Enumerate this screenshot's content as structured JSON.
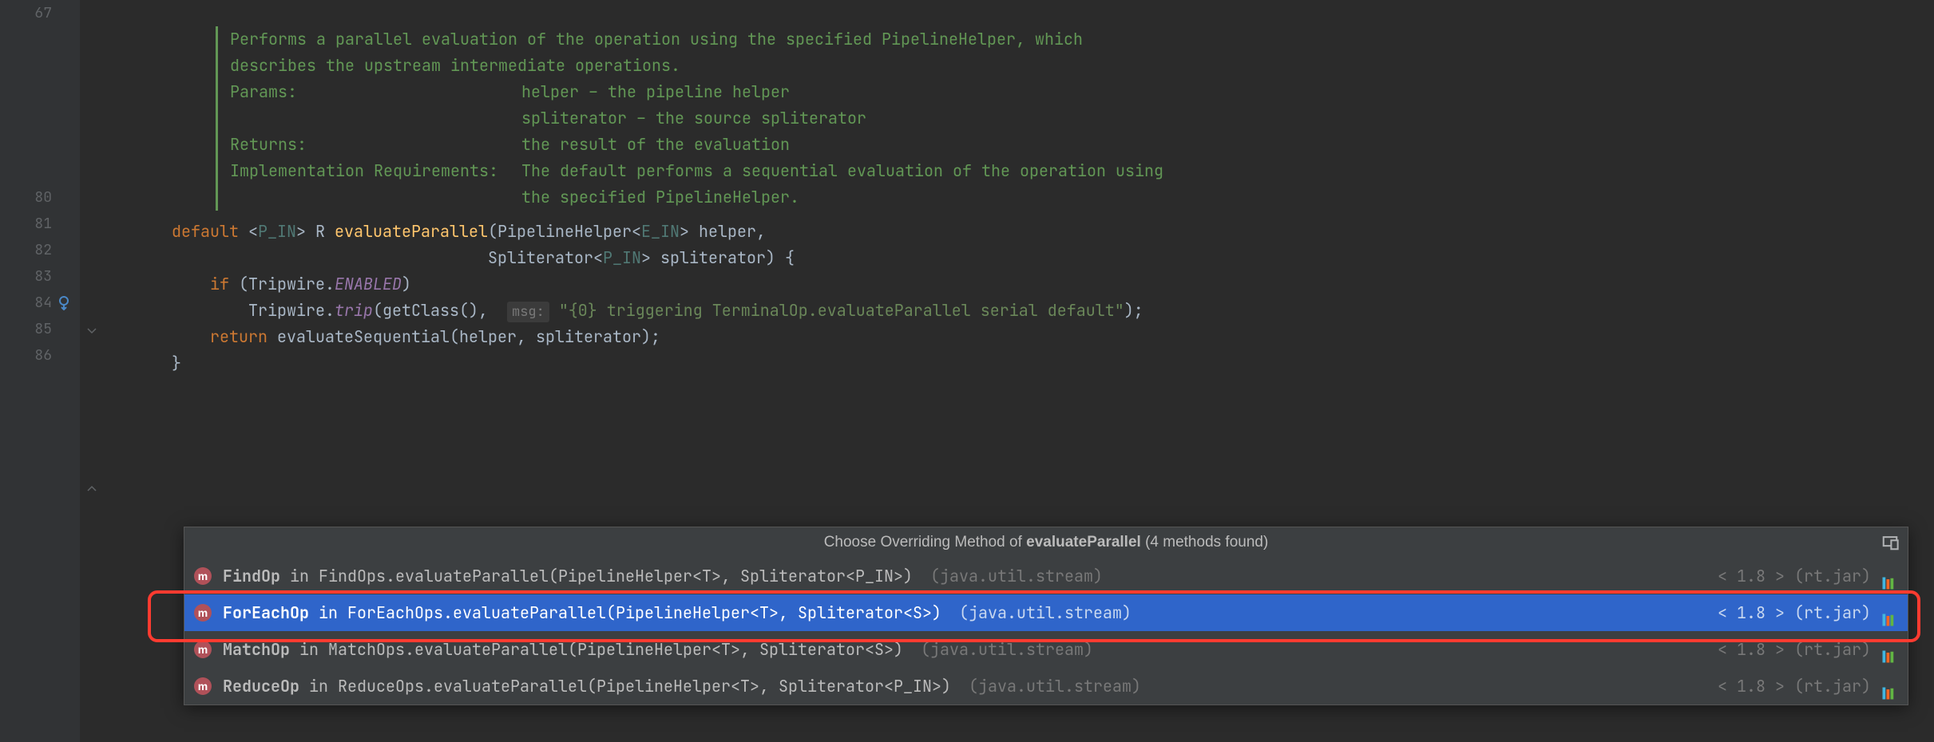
{
  "gutter": {
    "lines": [
      "67",
      "",
      "",
      "",
      "",
      "",
      "",
      "80",
      "81",
      "82",
      "83",
      "84",
      "85",
      "86"
    ]
  },
  "javadoc": {
    "desc1": "Performs a parallel evaluation of the operation using the specified PipelineHelper, which",
    "desc2": "describes the upstream intermediate operations.",
    "params_label": "Params:",
    "param1": "helper – the pipeline helper",
    "param2": "spliterator – the source spliterator",
    "returns_label": "Returns:",
    "returns_value": "the result of the evaluation",
    "impl_label": "Implementation Requirements:",
    "impl_value1": "The default performs a sequential evaluation of the operation using",
    "impl_value2": "the specified PipelineHelper."
  },
  "code": {
    "l80": {
      "default": "default ",
      "lt": "<",
      "p_in": "P_IN",
      "gt_r": "> R ",
      "method": "evaluateParallel",
      "params1": "(PipelineHelper<",
      "e_in": "E_IN",
      "params1_end": "> helper,"
    },
    "l81": {
      "indent": "                                 Spliterator<",
      "p_in": "P_IN",
      "end": "> spliterator) {"
    },
    "l82": {
      "indent": "    ",
      "if": "if ",
      "open": "(Tripwire.",
      "enabled": "ENABLED",
      "close": ")"
    },
    "l83": {
      "indent": "        Tripwire.",
      "trip": "trip",
      "open": "(getClass(),  ",
      "hint": "msg:",
      "space": " ",
      "string": "\"{0} triggering TerminalOp.evaluateParallel serial default\"",
      "close": ");"
    },
    "l84": {
      "indent": "    ",
      "return": "return ",
      "call": "evaluateSequential(helper, spliterator);"
    },
    "l85": {
      "brace": "}"
    }
  },
  "popup": {
    "title_prefix": "Choose Overriding Method of ",
    "title_method": "evaluateParallel",
    "title_suffix": " (4 methods found)",
    "items": [
      {
        "class": "FindOp",
        "sig": " in FindOps.evaluateParallel(PipelineHelper<T>, Spliterator<P_IN>) ",
        "pkg": "(java.util.stream)",
        "version": "< 1.8 > (rt.jar)"
      },
      {
        "class": "ForEachOp",
        "sig": " in ForEachOps.evaluateParallel(PipelineHelper<T>, Spliterator<S>) ",
        "pkg": "(java.util.stream)",
        "version": "< 1.8 > (rt.jar)"
      },
      {
        "class": "MatchOp",
        "sig": " in MatchOps.evaluateParallel(PipelineHelper<T>, Spliterator<S>) ",
        "pkg": "(java.util.stream)",
        "version": "< 1.8 > (rt.jar)"
      },
      {
        "class": "ReduceOp",
        "sig": " in ReduceOps.evaluateParallel(PipelineHelper<T>, Spliterator<P_IN>) ",
        "pkg": "(java.util.stream)",
        "version": "< 1.8 > (rt.jar)"
      }
    ],
    "selected_index": 1
  }
}
